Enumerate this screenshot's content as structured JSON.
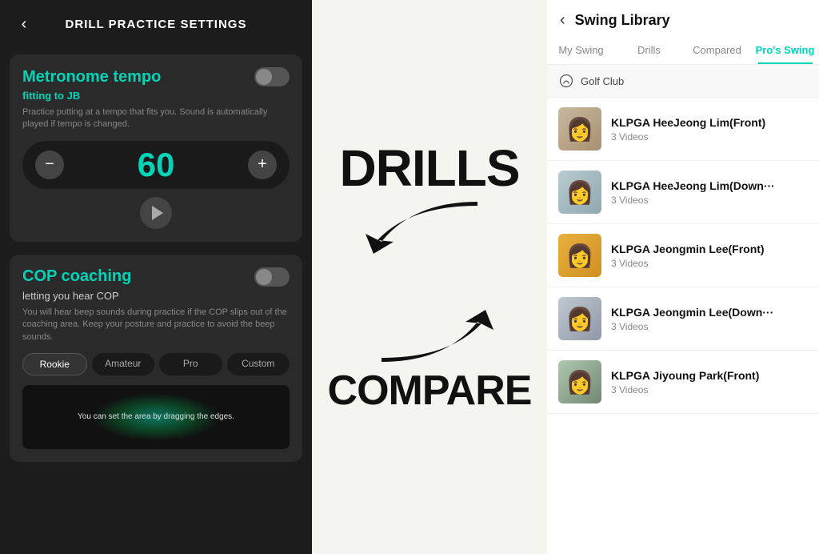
{
  "left": {
    "header": {
      "back_label": "‹",
      "title": "DRILL PRACTICE SETTINGS"
    },
    "metronome": {
      "title": "Metronome tempo",
      "subtitle": "fitting to",
      "subtitle_name": "JB",
      "description": "Practice putting at a tempo that fits you.\nSound is automatically played if tempo is changed.",
      "value": "60",
      "minus_label": "−",
      "plus_label": "+"
    },
    "cop": {
      "title": "COP coaching",
      "subtitle": "letting you hear COP",
      "description": "You will hear beep sounds during practice if the COP slips out of the coaching area.\nKeep your posture and practice to avoid the beep sounds.",
      "levels": [
        "Rookie",
        "Amateur",
        "Pro",
        "Custom"
      ],
      "active_level": "Rookie",
      "visual_text": "You can set the area\nby dragging the edges."
    }
  },
  "middle": {
    "drills_label": "DRILLS",
    "compare_label": "COMPARE"
  },
  "right": {
    "header": {
      "back_label": "‹",
      "title": "Swing Library"
    },
    "tabs": [
      {
        "label": "My Swing",
        "active": false
      },
      {
        "label": "Drills",
        "active": false
      },
      {
        "label": "Compared",
        "active": false
      },
      {
        "label": "Pro's Swing",
        "active": true
      }
    ],
    "section": {
      "label": "Golf Club"
    },
    "items": [
      {
        "name": "KLPGA HeeJeong Lim(Front)",
        "videos": "3 Videos",
        "avatar_class": "avatar-1"
      },
      {
        "name": "KLPGA HeeJeong Lim(Down···",
        "videos": "3 Videos",
        "avatar_class": "avatar-2"
      },
      {
        "name": "KLPGA Jeongmin Lee(Front)",
        "videos": "3 Videos",
        "avatar_class": "avatar-3"
      },
      {
        "name": "KLPGA Jeongmin Lee(Down···",
        "videos": "3 Videos",
        "avatar_class": "avatar-4"
      },
      {
        "name": "KLPGA Jiyoung Park(Front)",
        "videos": "3 Videos",
        "avatar_class": "avatar-5"
      }
    ]
  }
}
